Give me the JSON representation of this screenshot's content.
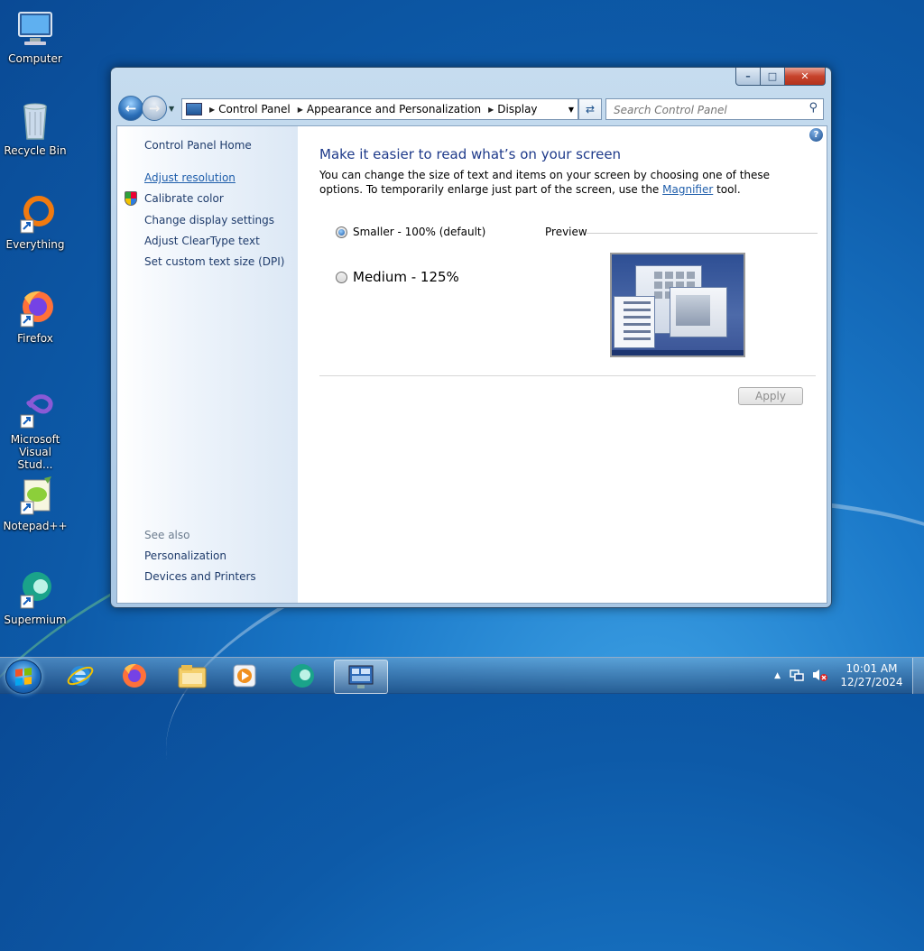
{
  "desktop": {
    "icons": [
      {
        "label": "Computer"
      },
      {
        "label": "Recycle Bin"
      },
      {
        "label": "Everything"
      },
      {
        "label": "Firefox"
      },
      {
        "label": "Microsoft Visual Stud..."
      },
      {
        "label": "Notepad++"
      },
      {
        "label": "Supermium"
      }
    ]
  },
  "window": {
    "caption": {
      "minimize": "–",
      "maximize": "□",
      "close": "✕"
    },
    "address": {
      "crumbs": [
        "Control Panel",
        "Appearance and Personalization",
        "Display"
      ]
    },
    "search": {
      "placeholder": "Search Control Panel"
    },
    "sidebar": {
      "home": "Control Panel Home",
      "tasks": [
        "Adjust resolution",
        "Calibrate color",
        "Change display settings",
        "Adjust ClearType text",
        "Set custom text size (DPI)"
      ],
      "see_also_label": "See also",
      "see_also": [
        "Personalization",
        "Devices and Printers"
      ]
    },
    "main": {
      "title": "Make it easier to read what’s on your screen",
      "desc_before": "You can change the size of text and items on your screen by choosing one of these options. To temporarily enlarge just part of the screen, use the ",
      "desc_link": "Magnifier",
      "desc_after": " tool.",
      "options": [
        {
          "label": "Smaller - 100% (default)",
          "selected": true
        },
        {
          "label": "Medium - 125%",
          "selected": false
        }
      ],
      "preview_label": "Preview",
      "apply_label": "Apply"
    }
  },
  "taskbar": {
    "clock_time": "10:01 AM",
    "clock_date": "12/27/2024"
  }
}
